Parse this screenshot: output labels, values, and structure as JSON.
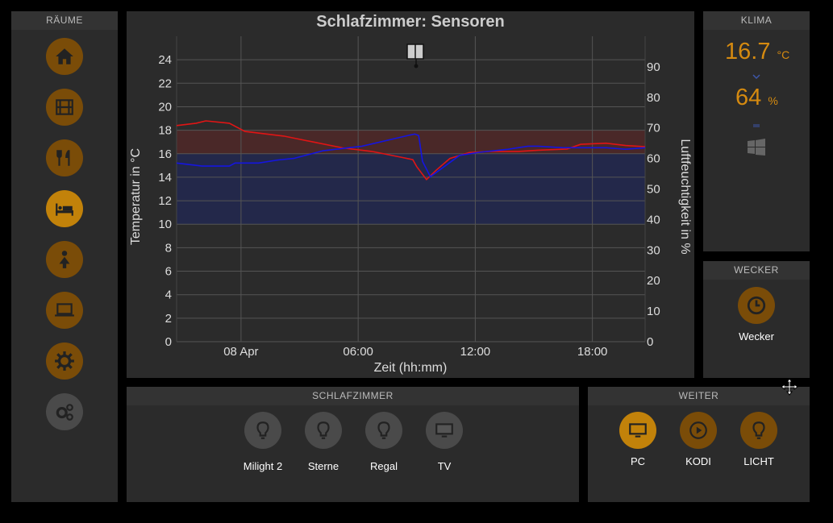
{
  "rooms": {
    "header": "RÄUME",
    "items": [
      {
        "name": "home",
        "icon": "home-icon"
      },
      {
        "name": "film",
        "icon": "film-icon"
      },
      {
        "name": "dining",
        "icon": "cutlery-icon"
      },
      {
        "name": "bedroom",
        "icon": "bed-icon",
        "active": true
      },
      {
        "name": "child",
        "icon": "child-icon"
      },
      {
        "name": "office",
        "icon": "laptop-icon"
      },
      {
        "name": "settings",
        "icon": "gear-icon"
      },
      {
        "name": "system",
        "icon": "gears-icon"
      }
    ]
  },
  "klima": {
    "header": "KLIMA",
    "temperature": "16.7",
    "temperature_unit": "°C",
    "humidity": "64",
    "humidity_unit": "%"
  },
  "wecker": {
    "header": "WECKER",
    "button_label": "Wecker"
  },
  "schlafzimmer": {
    "header": "SCHLAFZIMMER",
    "buttons": [
      {
        "label": "Milight 2",
        "icon": "bulb-icon"
      },
      {
        "label": "Sterne",
        "icon": "bulb-icon"
      },
      {
        "label": "Regal",
        "icon": "bulb-icon"
      },
      {
        "label": "TV",
        "icon": "monitor-icon"
      }
    ]
  },
  "weiter": {
    "header": "WEITER",
    "buttons": [
      {
        "label": "PC",
        "icon": "monitor-icon"
      },
      {
        "label": "KODI",
        "icon": "play-icon"
      },
      {
        "label": "LICHT",
        "icon": "bulb-icon"
      }
    ]
  },
  "chart_data": {
    "type": "line",
    "title": "Schlafzimmer: Sensoren",
    "xlabel": "Zeit (hh:mm)",
    "ylabel": "Temperatur in °C",
    "y2label": "Luftfeuchtigkeit in %",
    "xlim": [
      0,
      24
    ],
    "ylim": [
      0,
      26
    ],
    "y2lim": [
      0,
      100
    ],
    "x_ticks": [
      {
        "x": 3.3,
        "label": "08 Apr"
      },
      {
        "x": 9.3,
        "label": "06:00"
      },
      {
        "x": 15.3,
        "label": "12:00"
      },
      {
        "x": 21.3,
        "label": "18:00"
      }
    ],
    "y_ticks": [
      0,
      2,
      4,
      6,
      8,
      10,
      12,
      14,
      16,
      18,
      20,
      22,
      24
    ],
    "y2_ticks": [
      0,
      10,
      20,
      30,
      40,
      50,
      60,
      70,
      80,
      90
    ],
    "bands": [
      {
        "from": 16,
        "to": 18,
        "color": "#4a2828",
        "axis": "y"
      },
      {
        "from": 10,
        "to": 16,
        "color": "#23284a",
        "axis": "y"
      }
    ],
    "grid": true,
    "colors": {
      "temperature": "#e01515",
      "humidity": "#1515e0"
    },
    "series": [
      {
        "name": "Temperatur",
        "axis": "y",
        "x": [
          0,
          1,
          1.5,
          2.7,
          3.5,
          5.5,
          7.0,
          8.5,
          10.0,
          11.5,
          12.1,
          12.3,
          12.8,
          13.3,
          14,
          15,
          16,
          17.5,
          18.5,
          20,
          20.7,
          22,
          23,
          24
        ],
        "values": [
          18.4,
          18.6,
          18.8,
          18.6,
          17.9,
          17.5,
          17.0,
          16.5,
          16.2,
          15.7,
          15.5,
          14.9,
          13.8,
          14.6,
          15.6,
          16.1,
          16.2,
          16.2,
          16.3,
          16.4,
          16.8,
          16.9,
          16.7,
          16.6
        ]
      },
      {
        "name": "Luftfeuchtigkeit",
        "axis": "y2",
        "x": [
          0,
          1.3,
          2.7,
          3.0,
          4.2,
          5.2,
          6.0,
          7.5,
          9.5,
          11.5,
          12.2,
          12.4,
          12.6,
          13.0,
          14.5,
          15.5,
          17,
          18.0,
          18.5,
          19.8,
          20.8,
          22,
          23,
          24
        ],
        "values": [
          58.5,
          57.5,
          57.5,
          58.5,
          58.5,
          59.5,
          60,
          62.5,
          64,
          67,
          68,
          67.5,
          59,
          54,
          61,
          62,
          63,
          64,
          64,
          63.5,
          63.5,
          63.5,
          63,
          63.5
        ]
      }
    ]
  }
}
